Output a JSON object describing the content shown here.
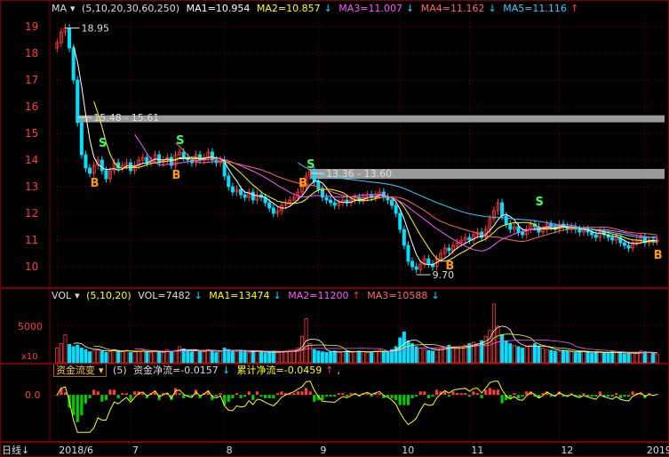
{
  "price_header": {
    "indicator": "MA",
    "params": "(5,10,20,30,60,250)",
    "ma1": "MA1=10.954",
    "ma2": "MA2=10.857",
    "ma3": "MA3=11.007",
    "ma4": "MA4=11.162",
    "ma5": "MA5=11.116"
  },
  "volume_header": {
    "indicator": "VOL",
    "params": "(5,10,20)",
    "vol": "VOL=7482",
    "ma1": "MA1=13474",
    "ma2": "MA2=11200",
    "ma3": "MA3=10588"
  },
  "flow_header": {
    "indicator": "资金流变",
    "params": "(5)",
    "net": "资金净流=-0.0157",
    "cum": "累计净流=-0.0459"
  },
  "period_label": "日线",
  "volume_unit": "x10",
  "colors": {
    "up": "#ff3b3b",
    "down": "#00e0ff",
    "ma1": "#ffffff",
    "ma2": "#ffff00",
    "ma3": "#ff55ff",
    "ma4": "#ff6666",
    "ma5": "#33ccff",
    "grid": "#7a0000"
  },
  "chart_data": [
    {
      "type": "candlestick",
      "y_ticks": [
        10,
        11,
        12,
        13,
        14,
        15,
        16,
        17,
        18,
        19
      ],
      "ylim": [
        9.4,
        19.4
      ],
      "x_ticks": [
        {
          "label": "2018/6",
          "index": 0
        },
        {
          "label": "7",
          "index": 18
        },
        {
          "label": "8",
          "index": 41
        },
        {
          "label": "9",
          "index": 64
        },
        {
          "label": "10",
          "index": 84
        },
        {
          "label": "11",
          "index": 101
        },
        {
          "label": "12",
          "index": 123
        },
        {
          "label": "2019/1",
          "index": 144
        }
      ],
      "closes": [
        18.4,
        18.8,
        18.95,
        18.2,
        17.0,
        15.4,
        14.2,
        13.7,
        13.5,
        13.8,
        14.0,
        13.6,
        13.3,
        13.6,
        13.9,
        13.7,
        13.8,
        13.9,
        13.6,
        13.8,
        14.0,
        14.1,
        13.9,
        14.0,
        14.2,
        13.9,
        14.0,
        14.1,
        13.8,
        14.2,
        14.3,
        14.1,
        14.0,
        13.9,
        14.2,
        14.0,
        14.1,
        14.3,
        14.0,
        13.9,
        14.0,
        13.4,
        13.0,
        12.8,
        12.9,
        12.7,
        12.6,
        12.8,
        12.5,
        12.7,
        12.6,
        12.4,
        12.2,
        12.0,
        12.1,
        12.3,
        12.4,
        12.5,
        12.6,
        12.8,
        13.0,
        13.4,
        13.6,
        13.2,
        12.9,
        12.6,
        12.5,
        12.4,
        12.3,
        12.4,
        12.5,
        12.4,
        12.5,
        12.6,
        12.5,
        12.6,
        12.7,
        12.6,
        12.7,
        12.8,
        12.6,
        12.5,
        12.3,
        12.0,
        11.4,
        10.8,
        10.2,
        10.0,
        9.9,
        10.1,
        10.3,
        10.1,
        10.0,
        10.3,
        10.5,
        10.7,
        10.6,
        10.8,
        10.9,
        11.0,
        11.1,
        11.0,
        11.2,
        11.3,
        11.1,
        11.4,
        11.8,
        12.1,
        12.4,
        11.9,
        11.6,
        11.4,
        11.5,
        11.3,
        11.2,
        11.4,
        11.6,
        11.5,
        11.3,
        11.4,
        11.6,
        11.5,
        11.4,
        11.6,
        11.5,
        11.4,
        11.5,
        11.4,
        11.3,
        11.4,
        11.3,
        11.2,
        11.1,
        11.3,
        11.2,
        11.1,
        11.0,
        11.1,
        10.9,
        10.8,
        10.7,
        10.9,
        11.0,
        11.1,
        10.9,
        11.0,
        10.95,
        11.0
      ],
      "ma_series": [
        {
          "name": "MA1",
          "window": 5
        },
        {
          "name": "MA2",
          "window": 10
        },
        {
          "name": "MA3",
          "window": 20
        },
        {
          "name": "MA4",
          "window": 30
        },
        {
          "name": "MA5",
          "window": 60
        }
      ],
      "annotations": [
        {
          "text": "18.95",
          "index": 2,
          "value": 18.95
        },
        {
          "text": "15.48 - 15.61",
          "index": 5,
          "value": 15.6
        },
        {
          "text": "13.36 - 13.60",
          "index": 62,
          "value": 13.5
        },
        {
          "text": "9.70",
          "index": 88,
          "value": 9.7
        }
      ],
      "bands": [
        {
          "low": 15.48,
          "high": 15.61,
          "from_index": 5
        },
        {
          "low": 13.36,
          "high": 13.6,
          "from_index": 62
        }
      ],
      "signals": [
        {
          "text": "S",
          "index": 11,
          "value": 14.5
        },
        {
          "text": "B",
          "index": 9,
          "value": 13.0
        },
        {
          "text": "S",
          "index": 30,
          "value": 14.6
        },
        {
          "text": "B",
          "index": 29,
          "value": 13.3
        },
        {
          "text": "S",
          "index": 62,
          "value": 13.7
        },
        {
          "text": "B",
          "index": 60,
          "value": 13.0
        },
        {
          "text": "B",
          "index": 96,
          "value": 9.9
        },
        {
          "text": "S",
          "index": 118,
          "value": 12.3
        },
        {
          "text": "B",
          "index": 147,
          "value": 10.3
        }
      ]
    },
    {
      "type": "bar",
      "name": "VOL",
      "y_ticks": [
        5000
      ],
      "ylim": [
        0,
        8000
      ],
      "values": [
        2000,
        2600,
        3800,
        2500,
        2200,
        2400,
        2000,
        1800,
        1500,
        1700,
        1900,
        1600,
        1400,
        1500,
        1800,
        1600,
        1500,
        1700,
        1400,
        1500,
        1600,
        1700,
        1500,
        1400,
        1600,
        1500,
        1400,
        1800,
        1500,
        1700,
        2200,
        1900,
        1600,
        1500,
        1700,
        1600,
        1500,
        1800,
        1600,
        1400,
        1600,
        2000,
        1800,
        1600,
        1500,
        1700,
        1600,
        1400,
        1500,
        1600,
        1400,
        1300,
        1500,
        1600,
        1400,
        1500,
        1600,
        1700,
        1800,
        2000,
        3600,
        6000,
        2600,
        1800,
        1600,
        1500,
        1400,
        1500,
        1600,
        1400,
        1500,
        1600,
        1400,
        1500,
        1600,
        1500,
        1400,
        1500,
        1600,
        1700,
        1600,
        1500,
        1800,
        2200,
        3400,
        4200,
        3000,
        2600,
        2200,
        2000,
        1800,
        1700,
        1600,
        1800,
        2000,
        2200,
        2400,
        2100,
        2000,
        2200,
        2400,
        2600,
        2800,
        2600,
        3000,
        3600,
        4400,
        8200,
        5000,
        3800,
        3000,
        2600,
        2400,
        2200,
        2000,
        2200,
        2400,
        2600,
        2200,
        2000,
        1800,
        1700,
        1600,
        1500,
        1700,
        1600,
        1500,
        1400,
        1500,
        1600,
        1400,
        1300,
        1500,
        1400,
        1300,
        1400,
        1500,
        1400,
        1300,
        1200,
        1300,
        1400,
        1300,
        1600,
        1500,
        1400,
        1300,
        1200
      ]
    },
    {
      "type": "bar",
      "name": "资金流变",
      "y_ticks": [
        0.0
      ],
      "ylim": [
        -0.6,
        0.25
      ]
    }
  ]
}
